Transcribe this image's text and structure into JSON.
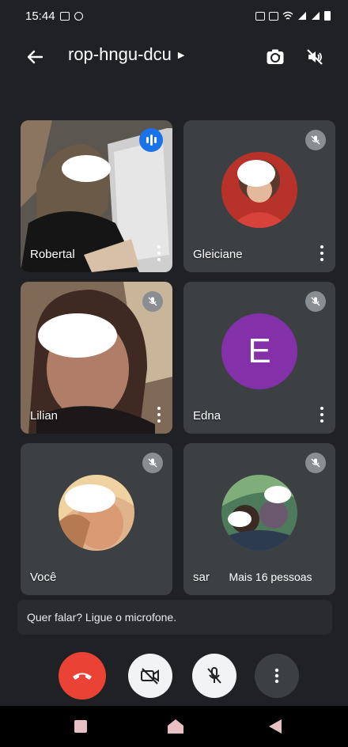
{
  "status_bar": {
    "time": "15:44"
  },
  "header": {
    "meeting_code": "rop-hngu-dcu"
  },
  "participants": [
    {
      "name": "Robertal",
      "state": "speaking"
    },
    {
      "name": "Gleiciane",
      "state": "muted"
    },
    {
      "name": "Lilian",
      "state": "muted"
    },
    {
      "name": "Edna",
      "state": "muted",
      "initial": "E",
      "avatar_color": "#8430a8"
    },
    {
      "name": "Você",
      "state": "muted"
    },
    {
      "name": "sar",
      "state": "muted"
    }
  ],
  "more_people_label": "Mais 16 pessoas",
  "hint_text": "Quer falar? Ligue o microfone.",
  "colors": {
    "end_call": "#ea4335",
    "speaking": "#1a73e8",
    "background": "#202124",
    "tile": "#3c4043"
  },
  "icons": {
    "back": "arrow-left-icon",
    "switch_camera": "switch-camera-icon",
    "audio_output": "speaker-off-icon",
    "end_call": "phone-hangup-icon",
    "camera": "camera-off-icon",
    "mic": "mic-off-icon",
    "more": "more-vert-icon"
  }
}
